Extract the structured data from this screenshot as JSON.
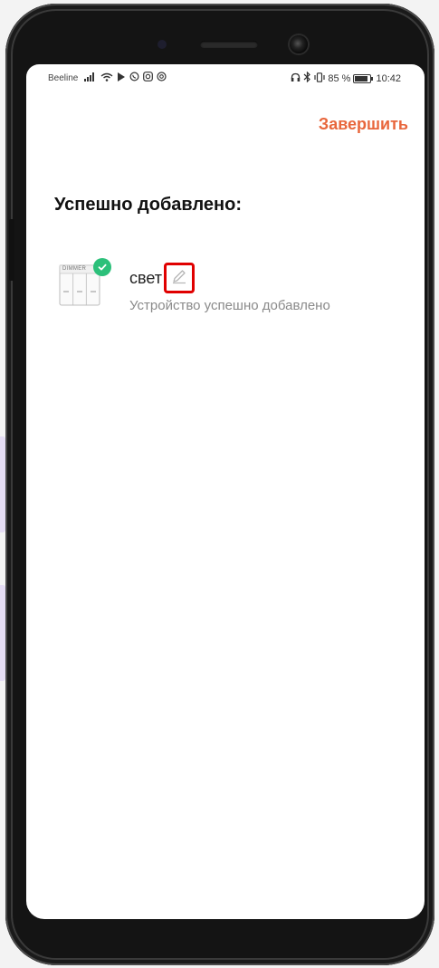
{
  "statusbar": {
    "carrier": "Beeline",
    "battery_text": "85 %",
    "battery_level": 0.85,
    "time": "10:42",
    "left_icons": [
      "signal-icon",
      "wifi-icon",
      "play-icon",
      "whatsapp-icon",
      "instagram-icon",
      "at-icon"
    ],
    "right_icons": [
      "headphones-icon",
      "bluetooth-icon",
      "vibrate-icon"
    ]
  },
  "header": {
    "finish_label": "Завершить"
  },
  "main": {
    "title": "Успешно добавлено:",
    "device": {
      "thumbnail_label": "DIMMER",
      "name": "свет",
      "status": "Устройство успешно добавлено"
    }
  },
  "colors": {
    "accent": "#e8663c",
    "success": "#2cc07a",
    "highlight": "#e00000"
  }
}
